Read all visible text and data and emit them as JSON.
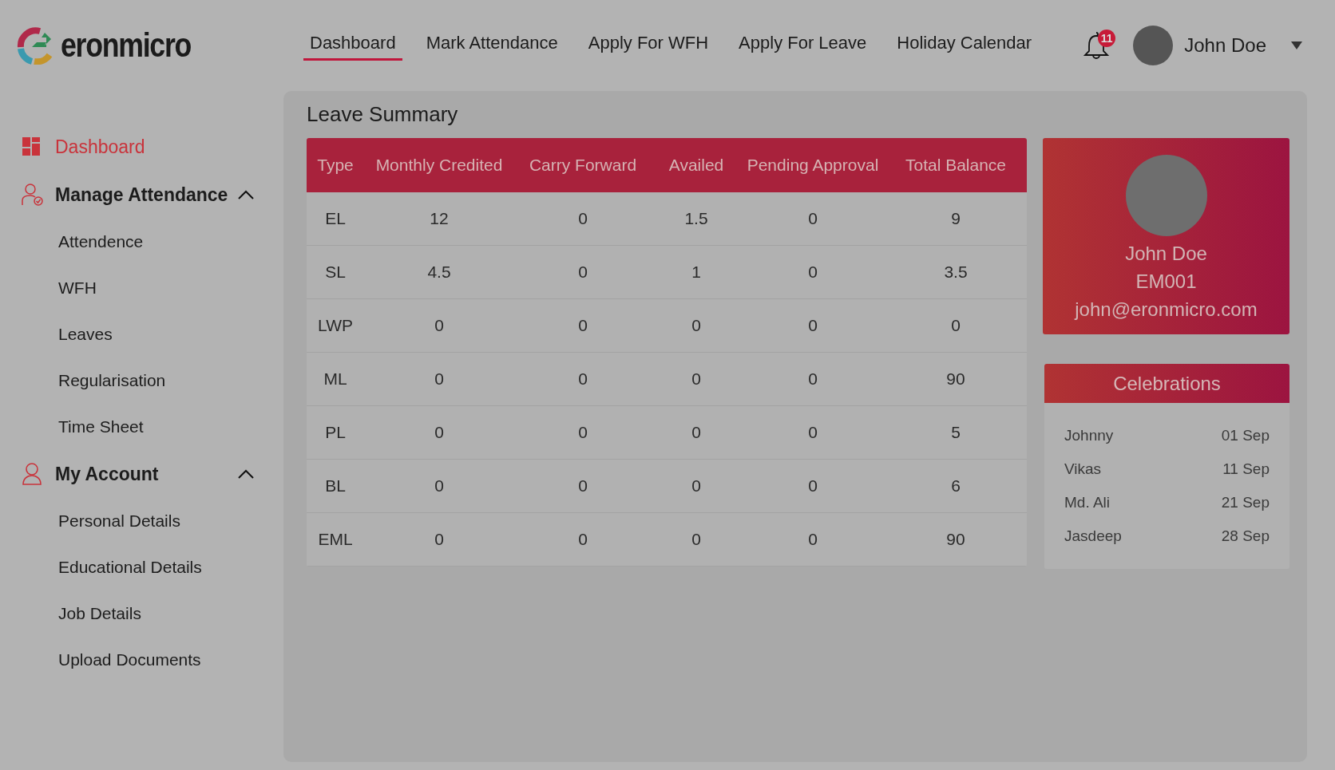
{
  "logo": {
    "text": "eronmicro"
  },
  "nav": [
    {
      "label": "Dashboard",
      "selected": true
    },
    {
      "label": "Mark Attendance",
      "selected": false
    },
    {
      "label": "Apply For WFH",
      "selected": false
    },
    {
      "label": "Apply For Leave",
      "selected": false
    },
    {
      "label": "Holiday Calendar",
      "selected": false
    }
  ],
  "notifications": {
    "count": "11"
  },
  "user": {
    "name": "John Doe"
  },
  "sidebar": {
    "items": [
      {
        "label": "Dashboard",
        "selected": true
      },
      {
        "label": "Manage Attendance",
        "selected": false,
        "expanded": true,
        "children": [
          {
            "label": "Attendence",
            "selected": false
          },
          {
            "label": "WFH",
            "selected": false
          },
          {
            "label": "Leaves",
            "selected": false
          },
          {
            "label": "Regularisation",
            "selected": false
          },
          {
            "label": "Time Sheet",
            "selected": false
          }
        ]
      },
      {
        "label": "My Account",
        "selected": false,
        "expanded": true,
        "children": [
          {
            "label": "Personal Details",
            "selected": false
          },
          {
            "label": "Educational Details",
            "selected": false
          },
          {
            "label": "Job Details",
            "selected": false
          },
          {
            "label": "Upload Documents",
            "selected": false
          }
        ]
      }
    ]
  },
  "leave_summary": {
    "title": "Leave Summary",
    "columns": [
      "Type",
      "Monthly Credited",
      "Carry Forward",
      "Availed",
      "Pending Approval",
      "Total Balance"
    ],
    "rows": [
      [
        "EL",
        "12",
        "0",
        "1.5",
        "0",
        "9"
      ],
      [
        "SL",
        "4.5",
        "0",
        "1",
        "0",
        "3.5"
      ],
      [
        "LWP",
        "0",
        "0",
        "0",
        "0",
        "0"
      ],
      [
        "ML",
        "0",
        "0",
        "0",
        "0",
        "90"
      ],
      [
        "PL",
        "0",
        "0",
        "0",
        "0",
        "5"
      ],
      [
        "BL",
        "0",
        "0",
        "0",
        "0",
        "6"
      ],
      [
        "EML",
        "0",
        "0",
        "0",
        "0",
        "90"
      ]
    ]
  },
  "profile": {
    "name": "John Doe",
    "employee_id": "EM001",
    "email": "john@eronmicro.com"
  },
  "celebrations": {
    "title": "Celebrations",
    "items": [
      {
        "name": "Johnny",
        "date": "01 Sep"
      },
      {
        "name": "Vikas",
        "date": "11 Sep"
      },
      {
        "name": "Md. Ali",
        "date": "21 Sep"
      },
      {
        "name": "Jasdeep",
        "date": "28 Sep"
      }
    ]
  }
}
